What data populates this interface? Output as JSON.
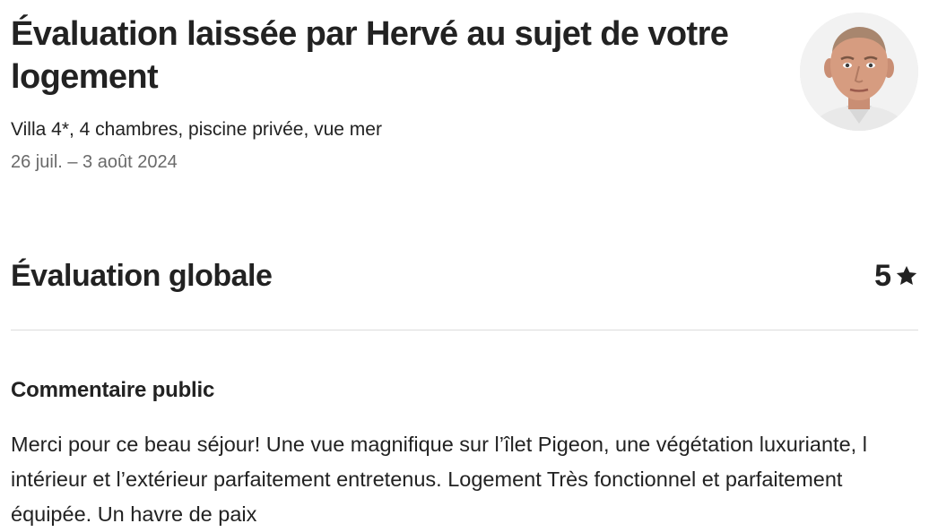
{
  "review": {
    "title": "Évaluation laissée par Hervé au sujet de votre logement",
    "listing_name": "Villa 4*, 4 chambres, piscine privée, vue mer",
    "dates": "26 juil. – 3 août 2024",
    "reviewer_avatar_alt": "Hervé"
  },
  "overall": {
    "label": "Évaluation globale",
    "rating": "5",
    "icon": "star-icon"
  },
  "comment": {
    "heading": "Commentaire public",
    "text": "Merci pour ce beau séjour! Une vue magnifique sur l’îlet Pigeon, une végétation luxuriante, l intérieur et l’extérieur parfaitement entretenus. Logement Très fonctionnel et parfaitement équipée. Un havre de paix"
  },
  "colors": {
    "text_primary": "#222222",
    "text_secondary": "#6a6a6a",
    "divider": "#dddddd"
  }
}
